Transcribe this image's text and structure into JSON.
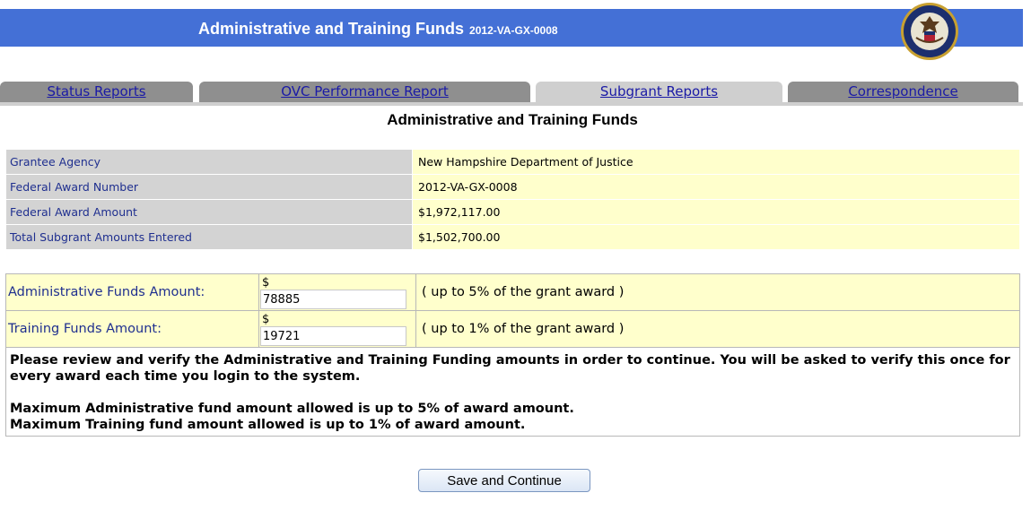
{
  "header": {
    "title": "Administrative and Training Funds",
    "award_code": "2012-VA-GX-0008",
    "seal_icon": "doj-seal-icon",
    "band_color": "#4470d6"
  },
  "tabs": [
    {
      "label": "Status Reports",
      "active": false
    },
    {
      "label": "OVC Performance Report",
      "active": false
    },
    {
      "label": "Subgrant Reports",
      "active": true
    },
    {
      "label": "Correspondence",
      "active": false
    }
  ],
  "page_title": "Administrative and Training Funds",
  "info": [
    {
      "label": "Grantee Agency",
      "value": "New Hampshire Department of Justice"
    },
    {
      "label": "Federal Award Number",
      "value": "2012-VA-GX-0008"
    },
    {
      "label": "Federal Award Amount",
      "value": "$1,972,117.00"
    },
    {
      "label": "Total Subgrant Amounts Entered",
      "value": "$1,502,700.00"
    }
  ],
  "funds": [
    {
      "label": "Administrative Funds Amount:",
      "currency": "$",
      "value": "78885",
      "note": "( up to 5% of the grant award )"
    },
    {
      "label": "Training Funds Amount:",
      "currency": "$",
      "value": "19721",
      "note": "( up to 1% of the grant award )"
    }
  ],
  "notice": {
    "line1": "Please review and verify the Administrative and Training Funding amounts in order to continue. You will be asked to verify this once for every award each time you login to the system.",
    "line2": "Maximum Administrative fund amount allowed is up to 5% of award amount.",
    "line3": "Maximum Training fund amount allowed is up to 1% of award amount."
  },
  "save_button": "Save and Continue"
}
